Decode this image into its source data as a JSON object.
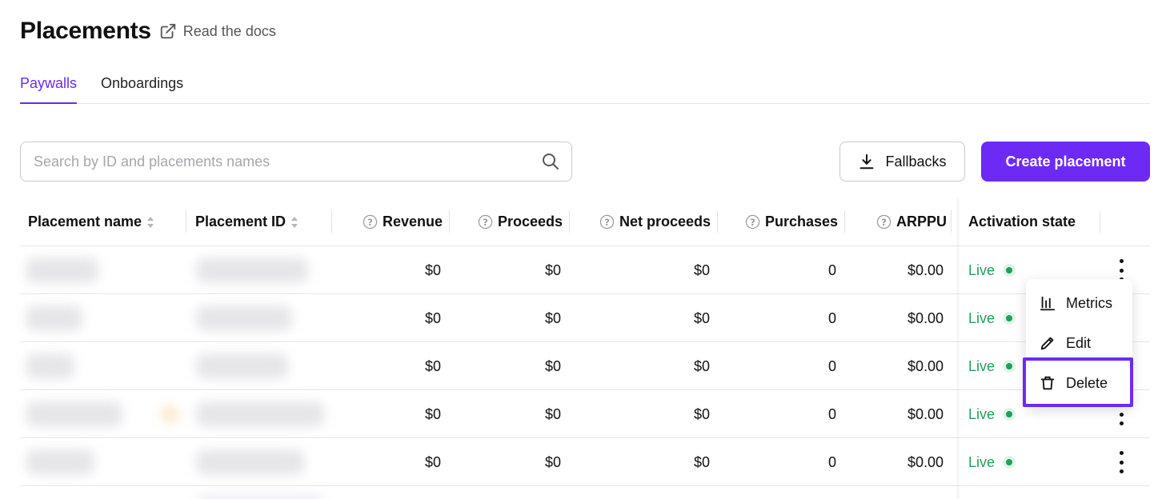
{
  "header": {
    "title": "Placements",
    "docs_link": "Read the docs"
  },
  "tabs": [
    {
      "label": "Paywalls",
      "active": true
    },
    {
      "label": "Onboardings",
      "active": false
    }
  ],
  "search": {
    "placeholder": "Search by ID and placements names",
    "value": ""
  },
  "toolbar": {
    "fallbacks_label": "Fallbacks",
    "create_label": "Create placement"
  },
  "table": {
    "columns": [
      "Placement name",
      "Placement ID",
      "Revenue",
      "Proceeds",
      "Net proceeds",
      "Purchases",
      "ARPPU",
      "Activation state"
    ],
    "rows": [
      {
        "revenue": "$0",
        "proceeds": "$0",
        "net_proceeds": "$0",
        "purchases": "0",
        "arppu": "$0.00",
        "state": "Live"
      },
      {
        "revenue": "$0",
        "proceeds": "$0",
        "net_proceeds": "$0",
        "purchases": "0",
        "arppu": "$0.00",
        "state": "Live"
      },
      {
        "revenue": "$0",
        "proceeds": "$0",
        "net_proceeds": "$0",
        "purchases": "0",
        "arppu": "$0.00",
        "state": "Live"
      },
      {
        "revenue": "$0",
        "proceeds": "$0",
        "net_proceeds": "$0",
        "purchases": "0",
        "arppu": "$0.00",
        "state": "Live"
      },
      {
        "revenue": "$0",
        "proceeds": "$0",
        "net_proceeds": "$0",
        "purchases": "0",
        "arppu": "$0.00",
        "state": "Live"
      }
    ]
  },
  "context_menu": {
    "metrics": "Metrics",
    "edit": "Edit",
    "delete": "Delete"
  },
  "colors": {
    "accent": "#6d2af5",
    "live": "#1fa05a",
    "border": "#e6e6ea"
  }
}
